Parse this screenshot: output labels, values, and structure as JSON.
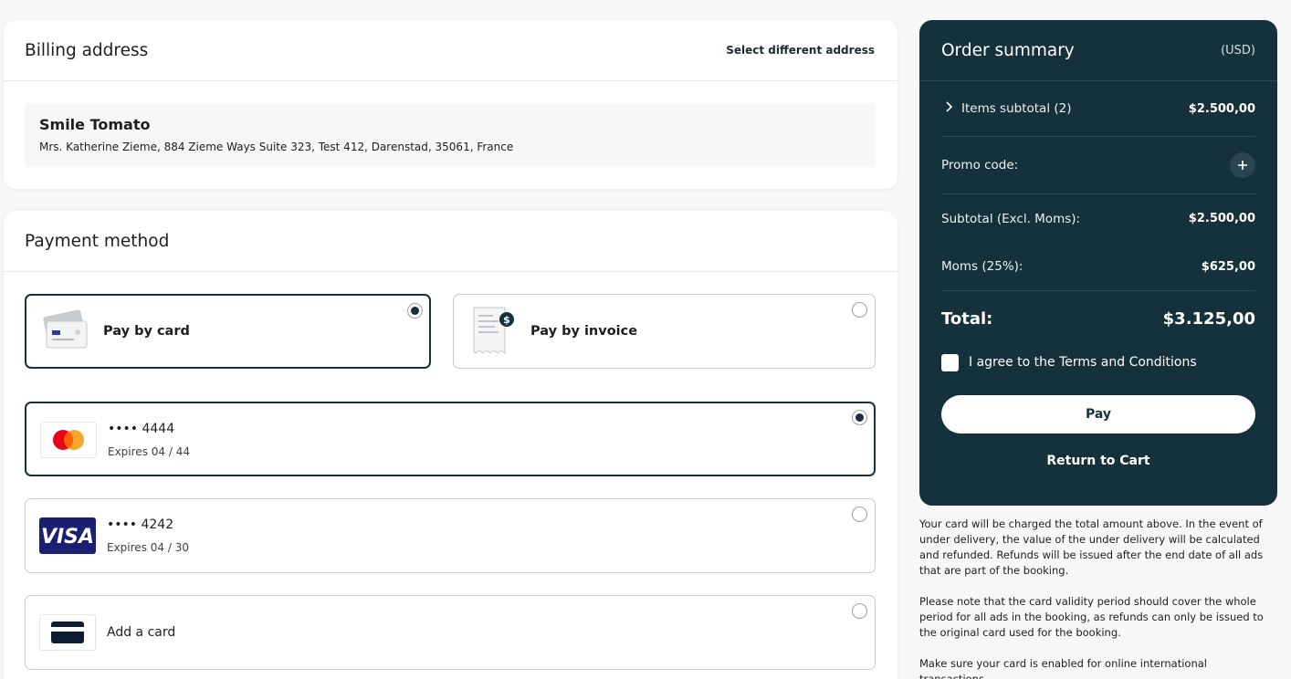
{
  "billing": {
    "title": "Billing address",
    "select_link": "Select different address",
    "name": "Smile Tomato",
    "address": "Mrs. Katherine Zieme, 884 Zieme Ways Suite 323, Test 412, Darenstad, 35061, France"
  },
  "payment": {
    "title": "Payment method",
    "methods": [
      {
        "label": "Pay by card",
        "selected": true
      },
      {
        "label": "Pay by invoice",
        "selected": false
      }
    ],
    "cards": [
      {
        "number": "•••• 4444",
        "expires": "Expires 04 / 44",
        "brand": "mastercard-icon",
        "selected": true
      },
      {
        "number": "•••• 4242",
        "expires": "Expires 04 / 30",
        "brand": "visa-icon",
        "selected": false
      }
    ],
    "add_card": "Add a card"
  },
  "summary": {
    "title": "Order summary",
    "currency": "(USD)",
    "items_label": "Items subtotal (2)",
    "items_value": "$2.500,00",
    "promo_label": "Promo code:",
    "subtotal_label": "Subtotal (Excl. Moms):",
    "subtotal_value": "$2.500,00",
    "tax_label": "Moms (25%):",
    "tax_value": "$625,00",
    "total_label": "Total:",
    "total_value": "$3.125,00",
    "agree_text": "I agree to the Terms and Conditions",
    "pay_label": "Pay",
    "return_label": "Return to Cart"
  },
  "notes": [
    "Your card will be charged the total amount above. In the event of under delivery, the value of the under delivery will be calculated and refunded. Refunds will be issued after the end date of all ads that are part of the booking.",
    "Please note that the card validity period should cover the whole period for all ads in the booking, as refunds can only be issued to the original card used for the booking.",
    "Make sure your card is enabled for online international transactions."
  ],
  "colors": {
    "accent": "#15313c",
    "mastercard_red": "#eb001b",
    "mastercard_yellow": "#f79e1b",
    "visa_blue": "#1a1f71"
  }
}
